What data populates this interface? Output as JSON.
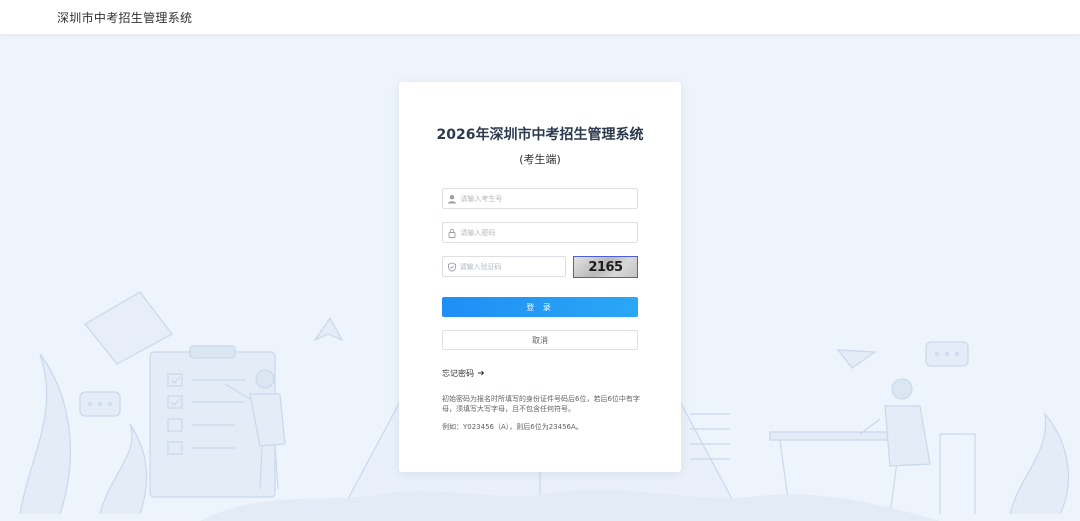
{
  "header": {
    "system_title": "深圳市中考招生管理系统"
  },
  "login": {
    "title": "2026年深圳市中考招生管理系统",
    "subtitle": "(考生端)",
    "username_placeholder": "请输入考生号",
    "password_placeholder": "请输入密码",
    "captcha_placeholder": "请输入验证码",
    "captcha_text": "2165",
    "login_button": "登 录",
    "cancel_button": "取消",
    "forgot_password": "忘记密码",
    "note_line1": "初始密码为报名时所填写的身份证件号码后6位，若后6位中有字母，须填写大写字母，且不包含任何符号。",
    "note_line2": "例如：Y023456（A），则后6位为23456A。"
  },
  "icons": {
    "user": "user-icon",
    "lock": "lock-icon",
    "shield": "shield-icon",
    "arrow": "arrow-right-icon"
  },
  "colors": {
    "primary": "#1f8ef5",
    "background": "#eef4fb",
    "captcha_border": "#4a5ed6"
  }
}
